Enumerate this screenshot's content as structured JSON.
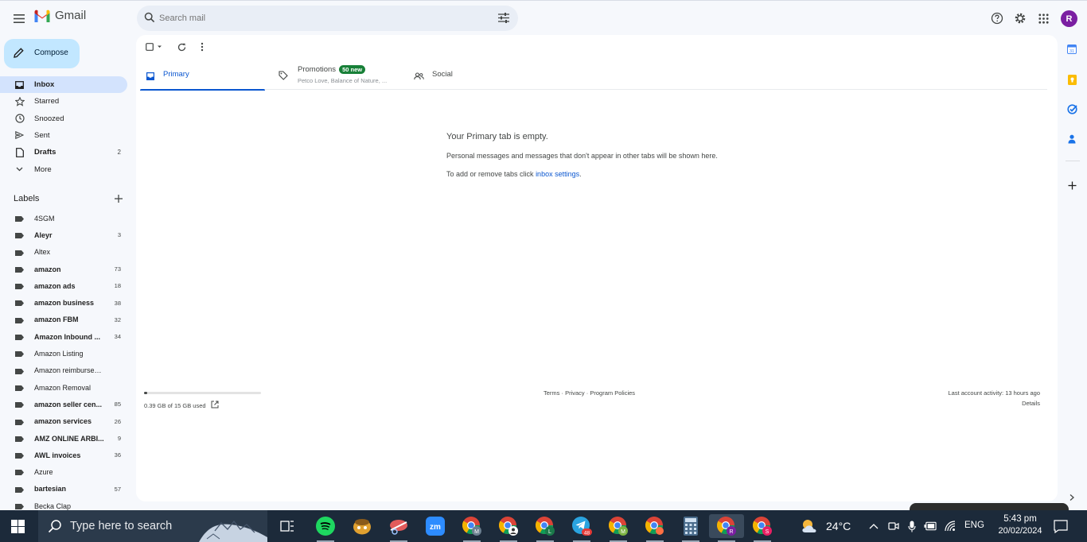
{
  "app": {
    "name": "Gmail"
  },
  "search": {
    "placeholder": "Search mail"
  },
  "compose": {
    "label": "Compose"
  },
  "nav": [
    {
      "label": "Inbox",
      "count": "",
      "icon": "inbox-icon",
      "active": true,
      "bold": true
    },
    {
      "label": "Starred",
      "count": "",
      "icon": "star-icon"
    },
    {
      "label": "Snoozed",
      "count": "",
      "icon": "clock-icon"
    },
    {
      "label": "Sent",
      "count": "",
      "icon": "send-icon"
    },
    {
      "label": "Drafts",
      "count": "2",
      "icon": "draft-icon",
      "bold": true
    },
    {
      "label": "More",
      "count": "",
      "icon": "chevron-down-icon"
    }
  ],
  "labels_heading": "Labels",
  "labels": [
    {
      "label": "4SGM",
      "count": "",
      "bold": false
    },
    {
      "label": "Aleyr",
      "count": "3",
      "bold": true
    },
    {
      "label": "Altex",
      "count": "",
      "bold": false
    },
    {
      "label": "amazon",
      "count": "73",
      "bold": true
    },
    {
      "label": "amazon ads",
      "count": "18",
      "bold": true
    },
    {
      "label": "amazon business",
      "count": "38",
      "bold": true
    },
    {
      "label": "amazon FBM",
      "count": "32",
      "bold": true
    },
    {
      "label": "Amazon Inbound ...",
      "count": "34",
      "bold": true
    },
    {
      "label": "Amazon Listing",
      "count": "",
      "bold": false
    },
    {
      "label": "Amazon reimbursement",
      "count": "",
      "bold": false
    },
    {
      "label": "Amazon Removal",
      "count": "",
      "bold": false
    },
    {
      "label": "amazon seller cen...",
      "count": "85",
      "bold": true
    },
    {
      "label": "amazon services",
      "count": "26",
      "bold": true
    },
    {
      "label": "AMZ ONLINE ARBI...",
      "count": "9",
      "bold": true
    },
    {
      "label": "AWL invoices",
      "count": "36",
      "bold": true
    },
    {
      "label": "Azure",
      "count": "",
      "bold": false
    },
    {
      "label": "bartesian",
      "count": "57",
      "bold": true
    },
    {
      "label": "Becka Clap",
      "count": "",
      "bold": false
    }
  ],
  "tabs": {
    "primary": "Primary",
    "promotions": "Promotions",
    "promotions_badge": "50 new",
    "promotions_senders": "Petco Love, Balance of Nature, ...",
    "social": "Social"
  },
  "empty": {
    "title": "Your Primary tab is empty.",
    "line1": "Personal messages and messages that don't appear in other tabs will be shown here.",
    "line2_prefix": "To add or remove tabs click ",
    "line2_link": "inbox settings",
    "line2_suffix": "."
  },
  "footer": {
    "storage": "0.39 GB of 15 GB used",
    "storage_fraction": 0.026,
    "terms": "Terms",
    "privacy": "Privacy",
    "policies": "Program Policies",
    "sep": " · ",
    "last_activity": "Last account activity: 13 hours ago",
    "details": "Details"
  },
  "account": {
    "initial": "R",
    "color": "#7b1fa2"
  },
  "taskbar": {
    "search_placeholder": "Type here to search",
    "temperature": "24°C",
    "language": "ENG",
    "time": "5:43 pm",
    "date": "20/02/2024",
    "telegram_badge": "48"
  },
  "colors": {
    "accent": "#0b57d0",
    "compose_bg": "#c2e7ff",
    "active_nav": "#d3e3fd",
    "promo_badge": "#188038"
  }
}
